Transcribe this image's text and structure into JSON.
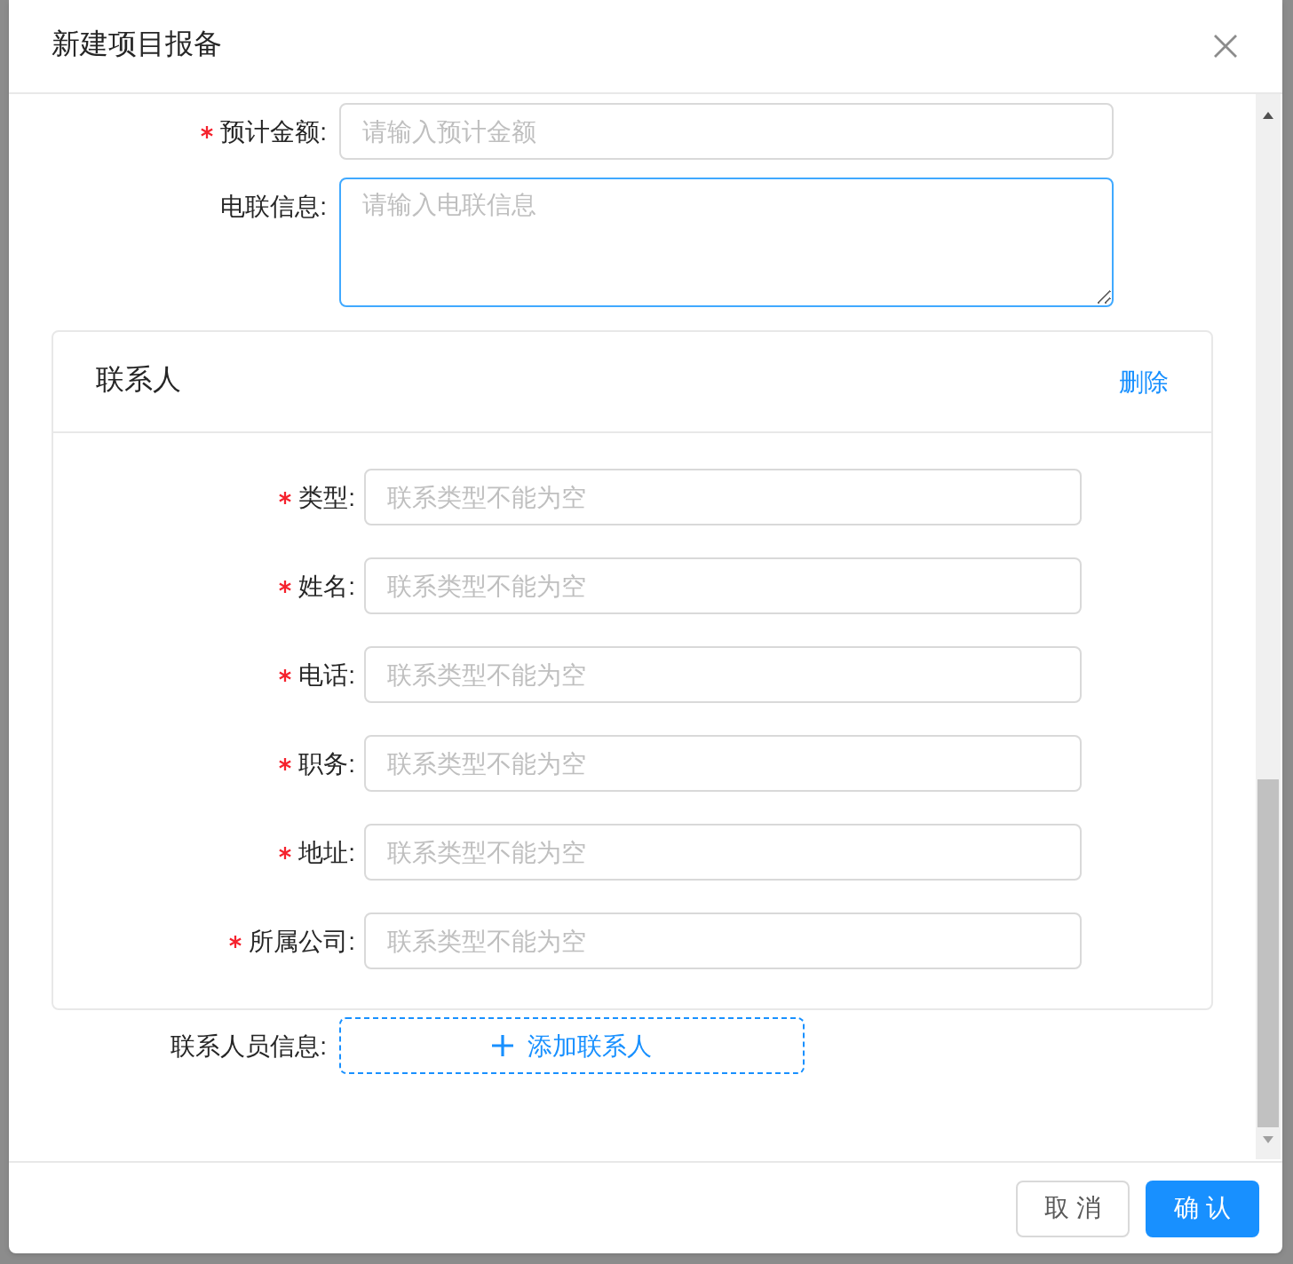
{
  "dialog": {
    "title": "新建项目报备"
  },
  "fields": [
    {
      "kind": "input",
      "label": "预计金额:",
      "required": true,
      "placeholder": "请输入预计金额",
      "focused": false
    },
    {
      "kind": "textarea",
      "label": "电联信息:",
      "required": false,
      "placeholder": "请输入电联信息",
      "focused": true
    }
  ],
  "contact_card": {
    "title": "联系人",
    "delete_link": "删除",
    "fields": [
      {
        "label": "类型:",
        "required": true,
        "placeholder": "联系类型不能为空"
      },
      {
        "label": "姓名:",
        "required": true,
        "placeholder": "联系类型不能为空"
      },
      {
        "label": "电话:",
        "required": true,
        "placeholder": "联系类型不能为空"
      },
      {
        "label": "职务:",
        "required": true,
        "placeholder": "联系类型不能为空"
      },
      {
        "label": "地址:",
        "required": true,
        "placeholder": "联系类型不能为空"
      },
      {
        "label": "所属公司:",
        "required": true,
        "placeholder": "联系类型不能为空"
      }
    ]
  },
  "add_contact": {
    "label": "联系人员信息:",
    "button": "添加联系人"
  },
  "footer": {
    "cancel": "取 消",
    "confirm": "确 认"
  }
}
